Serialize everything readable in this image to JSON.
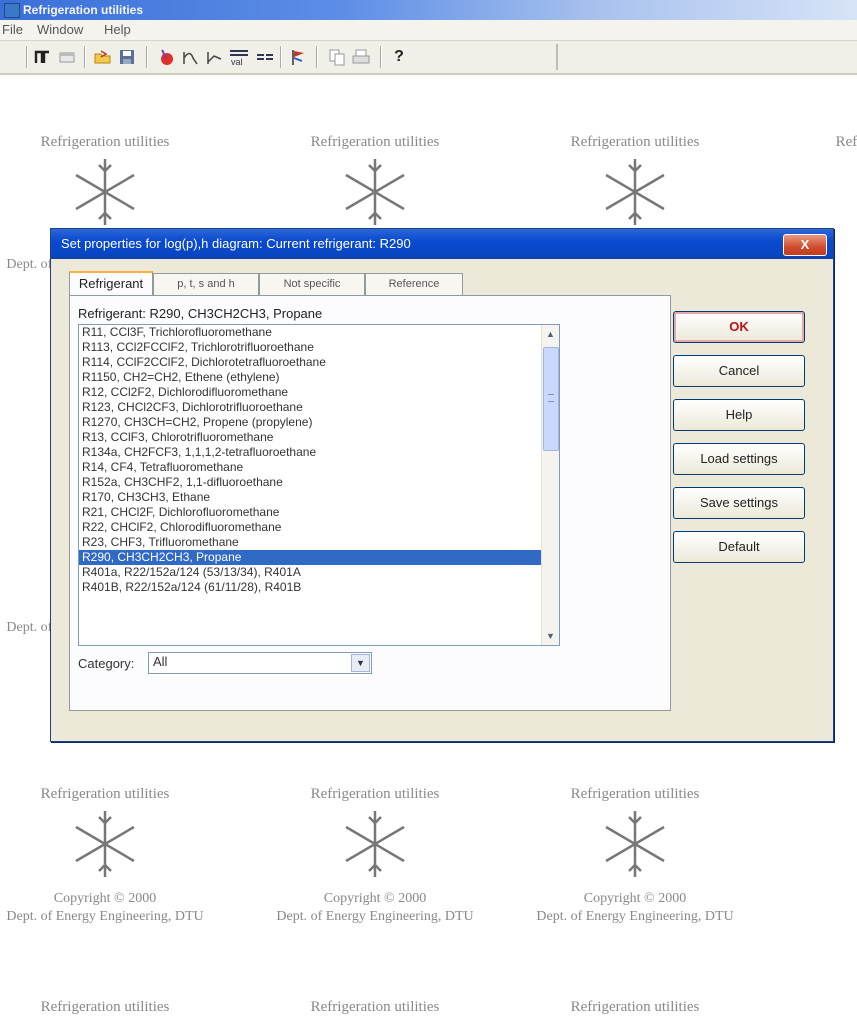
{
  "window": {
    "title": "Refrigeration utilities"
  },
  "menu": [
    "File",
    "Window",
    "Help"
  ],
  "toolbar": {
    "help_label": "?"
  },
  "tile": {
    "title": "Refrigeration utilities",
    "copyright": "Copyright © 2000",
    "dept": "Dept. of Energy Engineering, DTU"
  },
  "dialog": {
    "title": "Set properties for log(p),h diagram: Current refrigerant: R290",
    "close_label": "X",
    "tabs": [
      "Refrigerant",
      "p, t, s and h",
      "Not specific",
      "Reference"
    ],
    "refrigerant_label": "Refrigerant:",
    "refrigerant_value": "R290, CH3CH2CH3, Propane",
    "list": [
      "R11, CCl3F, Trichlorofluoromethane",
      "R113, CCl2FCClF2, Trichlorotrifluoroethane",
      "R114, CClF2CClF2, Dichlorotetrafluoroethane",
      "R1150, CH2=CH2, Ethene (ethylene)",
      "R12, CCl2F2, Dichlorodifluoromethane",
      "R123, CHCl2CF3, Dichlorotrifluoroethane",
      "R1270, CH3CH=CH2, Propene (propylene)",
      "R13, CClF3, Chlorotrifluoromethane",
      "R134a, CH2FCF3, 1,1,1,2-tetrafluoroethane",
      "R14, CF4, Tetrafluoromethane",
      "R152a, CH3CHF2, 1,1-difluoroethane",
      "R170, CH3CH3, Ethane",
      "R21, CHCl2F, Dichlorofluoromethane",
      "R22, CHClF2, Chlorodifluoromethane",
      "R23, CHF3, Trifluoromethane",
      "R290, CH3CH2CH3, Propane",
      "R401a, R22/152a/124 (53/13/34), R401A",
      "R401B, R22/152a/124 (61/11/28), R401B"
    ],
    "selected_index": 15,
    "category_label": "Category:",
    "category_value": "All",
    "buttons": {
      "ok": "OK",
      "cancel": "Cancel",
      "help": "Help",
      "load": "Load settings",
      "save": "Save settings",
      "default": "Default"
    }
  }
}
